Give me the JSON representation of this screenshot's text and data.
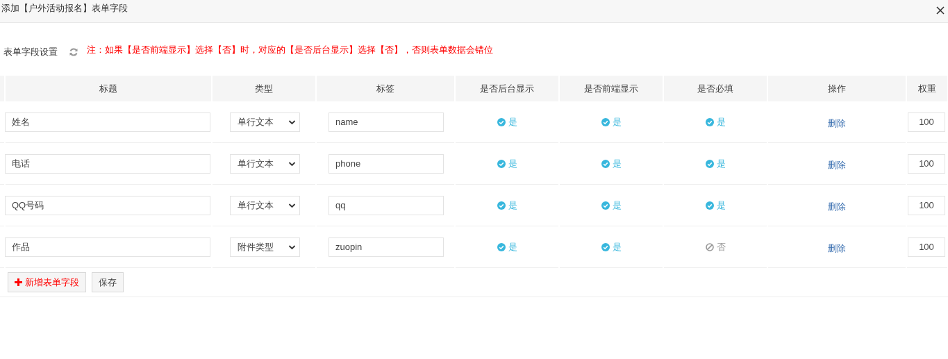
{
  "dialog": {
    "title": "添加【户外活动报名】表单字段"
  },
  "settings": {
    "label": "表单字段设置",
    "note": "注：如果【是否前端显示】选择【否】时，对应的【是否后台显示】选择【否】，否则表单数据会错位"
  },
  "table": {
    "columns": [
      "标题",
      "类型",
      "标签",
      "是否后台显示",
      "是否前端显示",
      "是否必填",
      "操作",
      "权重"
    ],
    "rows": [
      {
        "title": "姓名",
        "type": "单行文本",
        "tag": "name",
        "backend": {
          "on": true,
          "text": "是"
        },
        "frontend": {
          "on": true,
          "text": "是"
        },
        "required": {
          "on": true,
          "text": "是"
        },
        "action": "删除",
        "weight": "100"
      },
      {
        "title": "电话",
        "type": "单行文本",
        "tag": "phone",
        "backend": {
          "on": true,
          "text": "是"
        },
        "frontend": {
          "on": true,
          "text": "是"
        },
        "required": {
          "on": true,
          "text": "是"
        },
        "action": "删除",
        "weight": "100"
      },
      {
        "title": "QQ号码",
        "type": "单行文本",
        "tag": "qq",
        "backend": {
          "on": true,
          "text": "是"
        },
        "frontend": {
          "on": true,
          "text": "是"
        },
        "required": {
          "on": true,
          "text": "是"
        },
        "action": "删除",
        "weight": "100"
      },
      {
        "title": "作品",
        "type": "附件类型",
        "tag": "zuopin",
        "backend": {
          "on": true,
          "text": "是"
        },
        "frontend": {
          "on": true,
          "text": "是"
        },
        "required": {
          "on": false,
          "text": "否"
        },
        "action": "删除",
        "weight": "100"
      }
    ]
  },
  "buttons": {
    "add": "新增表单字段",
    "save": "保存"
  }
}
